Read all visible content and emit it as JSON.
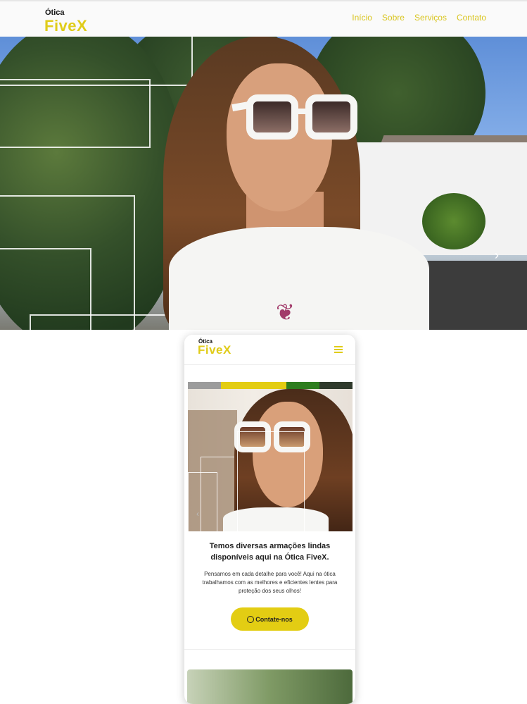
{
  "desktop": {
    "logo": {
      "small": "Ótica",
      "big": "FiveX"
    },
    "nav": [
      "Início",
      "Sobre",
      "Serviços",
      "Contato"
    ],
    "carousel": {
      "next_icon": "›"
    }
  },
  "mobile": {
    "logo": {
      "small": "Ótica",
      "big": "FiveX"
    },
    "menu_icon": "hamburger-icon",
    "carousel": {
      "prev_icon": "‹"
    },
    "stripe_colors": [
      "#9c9c9c",
      "#e3cd13",
      "#e3cd13",
      "#2e7d1f",
      "#2f3a2c"
    ],
    "headline": "Temos diversas armações lindas disponíveis aqui na Ótica FiveX.",
    "body": "Pensamos em cada detalhe para você! Aqui na ótica trabalhamos com as melhores e eficientes lentes para proteção dos seus olhos!",
    "cta_label": "Contate-nos"
  },
  "colors": {
    "brand_yellow": "#e0cc1a",
    "button_yellow": "#e3cd13"
  }
}
